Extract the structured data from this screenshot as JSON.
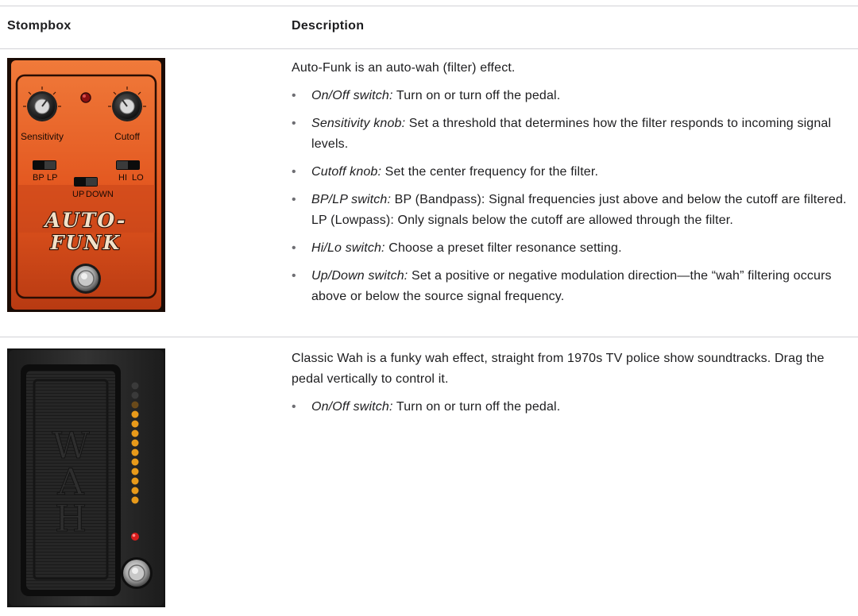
{
  "table": {
    "headers": {
      "stompbox": "Stompbox",
      "description": "Description"
    },
    "rows": [
      {
        "pedal": {
          "labels": {
            "sensitivity": "Sensitivity",
            "cutoff": "Cutoff",
            "bp": "BP",
            "lp": "LP",
            "hi": "HI",
            "lo": "LO",
            "up": "UP",
            "down": "DOWN",
            "logo_line1": "AUTO-",
            "logo_line2": "FUNK"
          },
          "colors": {
            "body": "#e2551e",
            "body_dark": "#b83a12"
          }
        },
        "intro": "Auto-Funk is an auto-wah (filter) effect.",
        "bullets": [
          {
            "term": "On/Off switch:",
            "text": " Turn on or turn off the pedal."
          },
          {
            "term": "Sensitivity knob:",
            "text": " Set a threshold that determines how the filter responds to incoming signal levels."
          },
          {
            "term": "Cutoff knob:",
            "text": " Set the center frequency for the filter."
          },
          {
            "term": "BP/LP switch:",
            "text": " BP (Bandpass): Signal frequencies just above and below the cutoff are filtered. LP (Lowpass): Only signals below the cutoff are allowed through the filter."
          },
          {
            "term": "Hi/Lo switch:",
            "text": " Choose a preset filter resonance setting."
          },
          {
            "term": "Up/Down switch:",
            "text": " Set a positive or negative modulation direction—the “wah” filtering occurs above or below the source signal frequency."
          }
        ]
      },
      {
        "pedal": {
          "labels": {
            "logo": [
              "W",
              "A",
              "H"
            ]
          },
          "colors": {
            "body": "#2b2b2b",
            "led_off": "#3a3a3a",
            "led_amber": "#e89a1a",
            "led_red": "#d81d1d"
          }
        },
        "intro": "Classic Wah is a funky wah effect, straight from 1970s TV police show soundtracks. Drag the pedal vertically to control it.",
        "bullets": [
          {
            "term": "On/Off switch:",
            "text": " Turn on or turn off the pedal."
          }
        ]
      }
    ]
  }
}
